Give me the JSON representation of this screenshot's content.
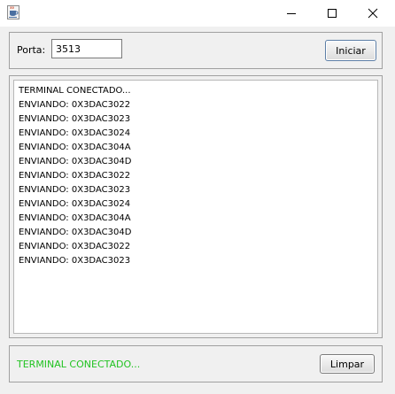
{
  "window": {
    "title": "",
    "accent_color": "#5c7ea6"
  },
  "titlebar": {
    "app_icon": "java-coffee-cup-icon",
    "minimize_icon": "minimize-icon",
    "maximize_icon": "maximize-icon",
    "close_icon": "close-icon"
  },
  "connection": {
    "port_label": "Porta:",
    "port_value": "3513",
    "start_button_label": "Iniciar"
  },
  "log": {
    "lines": [
      "TERMINAL CONECTADO...",
      "ENVIANDO: 0X3DAC3022",
      "ENVIANDO: 0X3DAC3023",
      "ENVIANDO: 0X3DAC3024",
      "ENVIANDO: 0X3DAC304A",
      "ENVIANDO: 0X3DAC304D",
      "ENVIANDO: 0X3DAC3022",
      "ENVIANDO: 0X3DAC3023",
      "ENVIANDO: 0X3DAC3024",
      "ENVIANDO: 0X3DAC304A",
      "ENVIANDO: 0X3DAC304D",
      "ENVIANDO: 0X3DAC3022",
      "ENVIANDO: 0X3DAC3023"
    ]
  },
  "footer": {
    "status_text": "TERMINAL CONECTADO...",
    "status_color": "#22c322",
    "clear_button_label": "Limpar"
  }
}
